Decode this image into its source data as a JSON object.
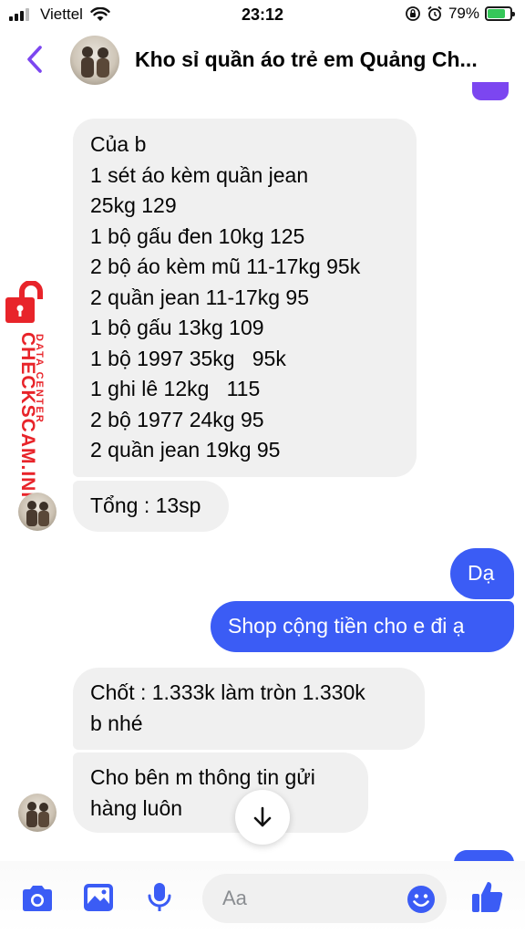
{
  "status_bar": {
    "carrier": "Viettel",
    "time": "23:12",
    "battery": "79%",
    "battery_level": 0.79
  },
  "header": {
    "title": "Kho sỉ quần áo trẻ em Quảng Ch..."
  },
  "watermark": {
    "brand": "CHECKSCAM.INFO",
    "subtitle": "DATA CENTER"
  },
  "messages": [
    {
      "side": "in",
      "lines": [
        "Của b",
        "1 sét áo kèm quần jean",
        "25kg 129",
        "1 bộ gấu đen 10kg 125",
        "2 bộ áo kèm mũ 11-17kg 95k",
        "2 quần jean 11-17kg 95",
        "1 bộ gấu 13kg 109",
        "1 bộ 1997 35kg   95k",
        "1 ghi lê 12kg   115",
        "2 bộ 1977 24kg 95",
        "2 quần jean 19kg 95"
      ]
    },
    {
      "side": "in",
      "lines": [
        "Tổng : 13sp"
      ]
    },
    {
      "side": "out",
      "lines": [
        "Dạ"
      ]
    },
    {
      "side": "out",
      "lines": [
        "Shop cộng tiền cho e đi ạ"
      ]
    },
    {
      "side": "in",
      "lines": [
        "Chốt : 1.333k làm tròn 1.330k",
        "b nhé"
      ]
    },
    {
      "side": "in",
      "lines": [
        "Cho bên m thông tin gửi",
        "hàng luôn"
      ]
    }
  ],
  "composer": {
    "placeholder": "Aa"
  },
  "colors": {
    "accent": "#7c46f0",
    "outgoing_bubble": "#3b5cf5",
    "incoming_bubble": "#f0f0f0",
    "watermark": "#e8242a"
  }
}
